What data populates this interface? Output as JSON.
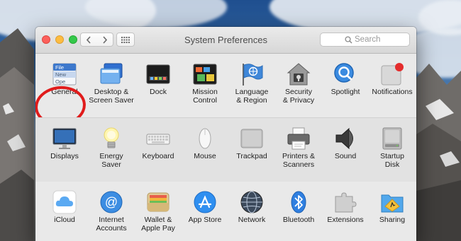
{
  "window": {
    "title": "System Preferences",
    "search_placeholder": "Search"
  },
  "toolbar": {
    "back_icon": "chevron-left-icon",
    "forward_icon": "chevron-right-icon",
    "show_all_icon": "grid-icon"
  },
  "rows": [
    [
      {
        "label": "General",
        "icon": "general-icon"
      },
      {
        "label": "Desktop &\nScreen Saver",
        "icon": "desktop-icon"
      },
      {
        "label": "Dock",
        "icon": "dock-icon"
      },
      {
        "label": "Mission\nControl",
        "icon": "mission-control-icon"
      },
      {
        "label": "Language\n& Region",
        "icon": "flag-icon"
      },
      {
        "label": "Security\n& Privacy",
        "icon": "house-icon"
      },
      {
        "label": "Spotlight",
        "icon": "magnifier-icon"
      },
      {
        "label": "Notifications",
        "icon": "notifications-icon"
      }
    ],
    [
      {
        "label": "Displays",
        "icon": "display-icon"
      },
      {
        "label": "Energy\nSaver",
        "icon": "lightbulb-icon"
      },
      {
        "label": "Keyboard",
        "icon": "keyboard-icon"
      },
      {
        "label": "Mouse",
        "icon": "mouse-icon"
      },
      {
        "label": "Trackpad",
        "icon": "trackpad-icon"
      },
      {
        "label": "Printers &\nScanners",
        "icon": "printer-icon"
      },
      {
        "label": "Sound",
        "icon": "speaker-icon"
      },
      {
        "label": "Startup\nDisk",
        "icon": "disk-icon"
      }
    ],
    [
      {
        "label": "iCloud",
        "icon": "cloud-icon"
      },
      {
        "label": "Internet\nAccounts",
        "icon": "at-icon"
      },
      {
        "label": "Wallet &\nApple Pay",
        "icon": "wallet-icon"
      },
      {
        "label": "App Store",
        "icon": "app-store-icon"
      },
      {
        "label": "Network",
        "icon": "globe-icon"
      },
      {
        "label": "Bluetooth",
        "icon": "bluetooth-icon"
      },
      {
        "label": "Extensions",
        "icon": "puzzle-icon"
      },
      {
        "label": "Sharing",
        "icon": "sharing-folder-icon"
      }
    ]
  ],
  "general_icon_text": [
    "File",
    "New",
    "Ope"
  ],
  "highlight": {
    "target": "General",
    "color": "#e01b1b"
  }
}
